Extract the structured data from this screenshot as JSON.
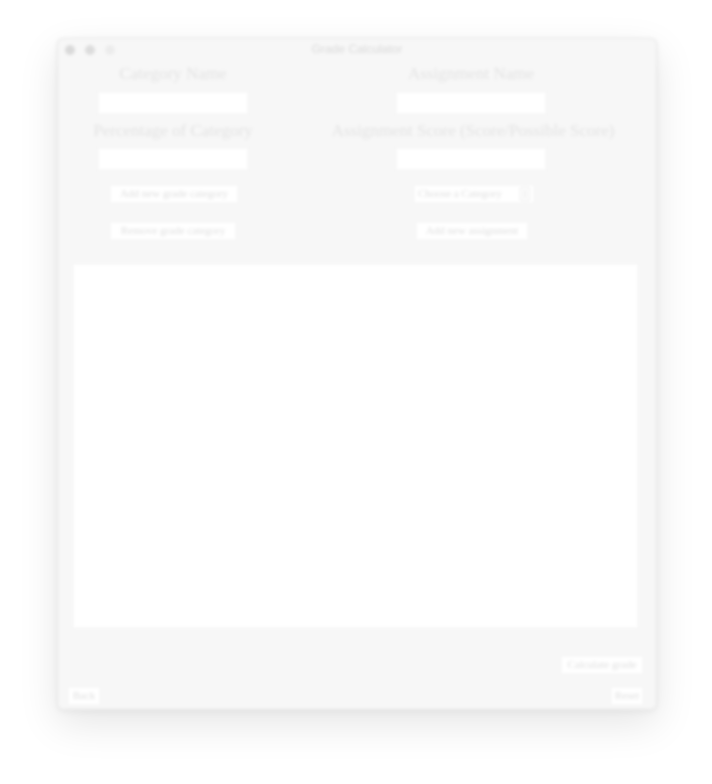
{
  "window": {
    "title": "Grade Calculator"
  },
  "category_form": {
    "name_label": "Category Name",
    "name_value": "",
    "percentage_label": "Percentage of Category",
    "percentage_value": "",
    "add_button": "Add new grade category",
    "remove_button": "Remove grade category"
  },
  "assignment_form": {
    "name_label": "Assignment Name",
    "name_value": "",
    "score_label": "Assignment Score (Score/Possible Score)",
    "score_value": "",
    "category_select": "Choose a Category",
    "add_button": "Add new assignment"
  },
  "results": {
    "text": ""
  },
  "footer": {
    "calculate_button": "Calculate grade",
    "back_button": "Back",
    "reset_button": "Reset"
  },
  "colors": {
    "window_bg": "#f7f7f7",
    "panel_bg": "#ffffff",
    "text": "#dcdcdc"
  },
  "icons": {
    "close": "close-circle",
    "minimize": "minimize-circle",
    "maximize": "maximize-circle",
    "select": "up-down-stepper"
  }
}
